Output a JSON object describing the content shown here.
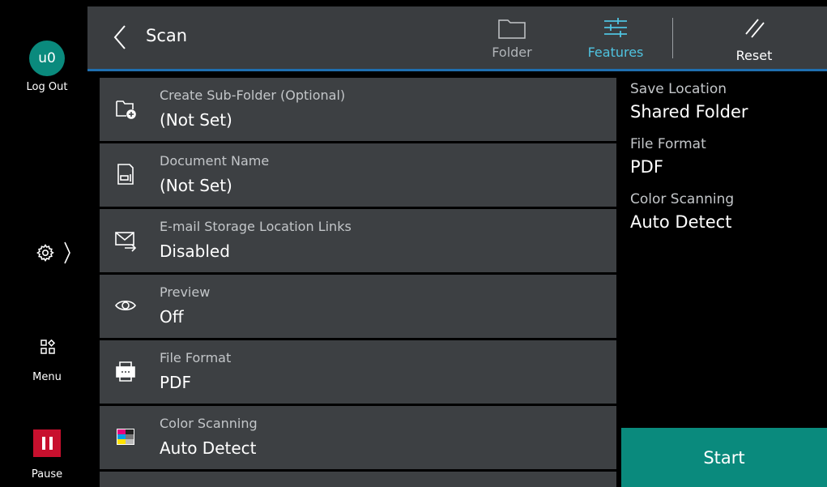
{
  "rail": {
    "avatar": "u0",
    "logout": "Log Out",
    "menu": "Menu",
    "pause": "Pause",
    "pause_color": "#c8102e"
  },
  "header": {
    "title": "Scan",
    "folder": "Folder",
    "features": "Features",
    "reset": "Reset",
    "active_color": "#4fc3e0"
  },
  "features": [
    {
      "icon": "sub-folder-add-icon",
      "label": "Create Sub-Folder (Optional)",
      "value": "(Not Set)"
    },
    {
      "icon": "document-name-icon",
      "label": "Document Name",
      "value": "(Not Set)"
    },
    {
      "icon": "envelope-arrow-icon",
      "label": "E-mail Storage Location Links",
      "value": "Disabled"
    },
    {
      "icon": "eye-icon",
      "label": "Preview",
      "value": "Off"
    },
    {
      "icon": "printer-file-icon",
      "label": "File Format",
      "value": "PDF"
    },
    {
      "icon": "color-swatch-icon",
      "label": "Color Scanning",
      "value": "Auto Detect"
    }
  ],
  "summary": {
    "items": [
      {
        "label": "Save Location",
        "value": "Shared Folder"
      },
      {
        "label": "File Format",
        "value": "PDF"
      },
      {
        "label": "Color Scanning",
        "value": "Auto Detect"
      }
    ]
  },
  "start": "Start",
  "colors": {
    "accent": "#0a8a7d",
    "header_bg": "#3a3d40",
    "row_bg": "#3d4043",
    "divider": "#1f6fb0"
  }
}
